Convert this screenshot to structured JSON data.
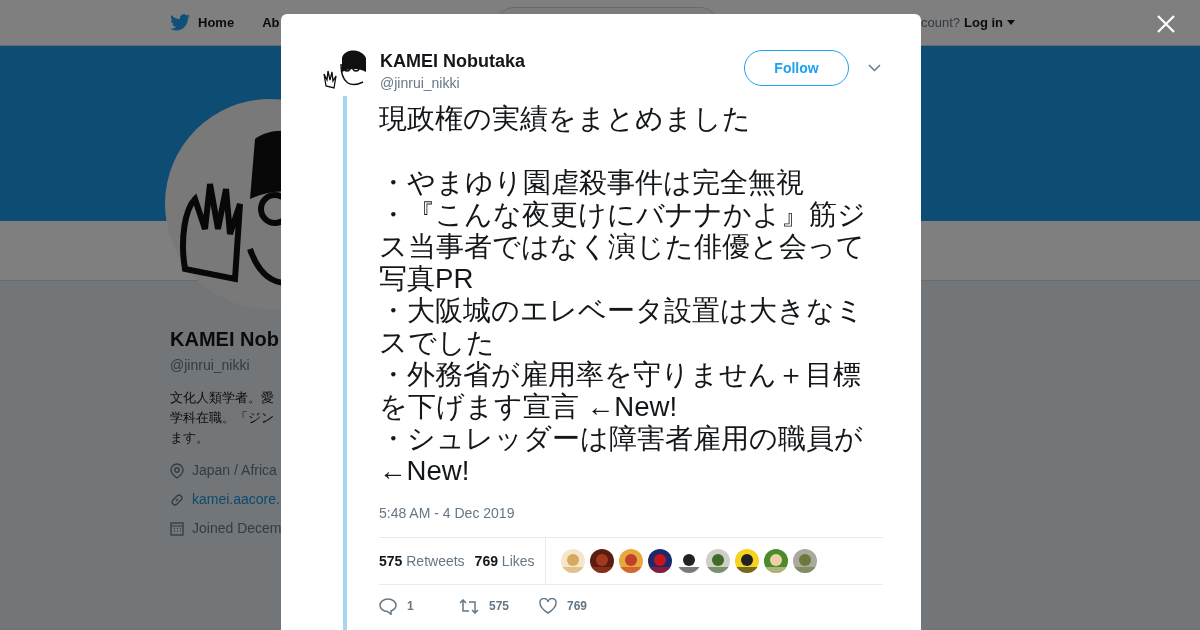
{
  "nav": {
    "items": [
      {
        "label": "Home"
      },
      {
        "label": "Ab"
      }
    ],
    "account_prompt": "count?",
    "login": "Log in"
  },
  "profile": {
    "name": "KAMEI Nob",
    "handle": "@jinrui_nikki",
    "bio": [
      "文化人類学者。愛",
      "学科在職。「ジン",
      "ます。"
    ],
    "location": "Japan / Africa",
    "url": "kamei.aacore.",
    "joined": "Joined Decem"
  },
  "tweet": {
    "name": "KAMEI Nobutaka",
    "handle": "@jinrui_nikki",
    "follow": "Follow",
    "text": [
      "現政権の実績をまとめました",
      "・やまゆり園虐殺事件は完全無視",
      "・『こんな夜更けにバナナかよ』筋ジス当事者ではなく演じた俳優と会って写真PR",
      "・大阪城のエレベータ設置は大きなミスでした",
      "・外務省が雇用率を守りません＋目標を下げます宣言 ←New!",
      "・シュレッダーは障害者雇用の職員が ←New!"
    ],
    "timestamp": "5:48 AM - 4 Dec 2019",
    "retweets": {
      "count": "575",
      "label": "Retweets"
    },
    "likes": {
      "count": "769",
      "label": "Likes"
    },
    "actions": {
      "replies": "1",
      "retweets": "575",
      "likes": "769"
    }
  }
}
